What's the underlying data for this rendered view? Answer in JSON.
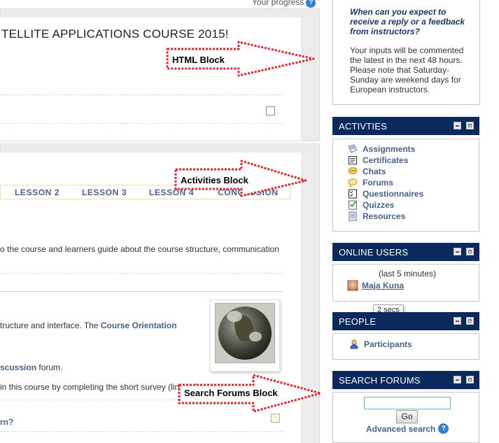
{
  "progress": {
    "label": "Your progress",
    "help_icon": "?"
  },
  "course": {
    "title": "TELLITE APPLICATIONS COURSE 2015!"
  },
  "tabs": [
    "LESSON 2",
    "LESSON 3",
    "LESSON 4",
    "CONCLUSION"
  ],
  "content": {
    "line1": "o the course and learners guide about the course structure, communication",
    "line2_prefix": "tructure and interface. The ",
    "line2_link": "Course Orientation",
    "line3_link": "scussion",
    "line3_suffix": " forum.",
    "line4": "in this course by completing the short survey (link below).",
    "line5_link": "rn?"
  },
  "annotations": {
    "html_block": "HTML Block",
    "activities_block": "Activities Block",
    "search_forums_block": "Search Forums Block"
  },
  "faq": {
    "question": "When can you expect to receive a reply or a feedback from instructors?",
    "answer": "Your inputs will be commented the latest in the next 48 hours. Please note that Saturday-Sunday are weekend days for European instructors."
  },
  "activities": {
    "title": "ACTIVTIES",
    "items": [
      {
        "label": "Assignments",
        "icon": "assignment-icon"
      },
      {
        "label": "Certificates",
        "icon": "certificate-icon"
      },
      {
        "label": "Chats",
        "icon": "chat-icon"
      },
      {
        "label": "Forums",
        "icon": "forum-icon"
      },
      {
        "label": "Questionnaires",
        "icon": "questionnaire-icon"
      },
      {
        "label": "Quizzes",
        "icon": "quiz-icon"
      },
      {
        "label": "Resources",
        "icon": "resource-icon"
      }
    ]
  },
  "online_users": {
    "title": "ONLINE USERS",
    "period": "(last 5 minutes)",
    "user": "Maja Kuna",
    "tooltip": "2 secs"
  },
  "people": {
    "title": "PEOPLE",
    "participants": "Participants"
  },
  "search_forums": {
    "title": "SEARCH FORUMS",
    "input_value": "",
    "go_label": "Go",
    "advanced_label": "Advanced search",
    "help_icon": "?"
  },
  "colors": {
    "block_header": "#0a2a5e",
    "link": "#4a6288",
    "faq_question": "#1e3669",
    "annotation_arrow": "#e0242e"
  }
}
